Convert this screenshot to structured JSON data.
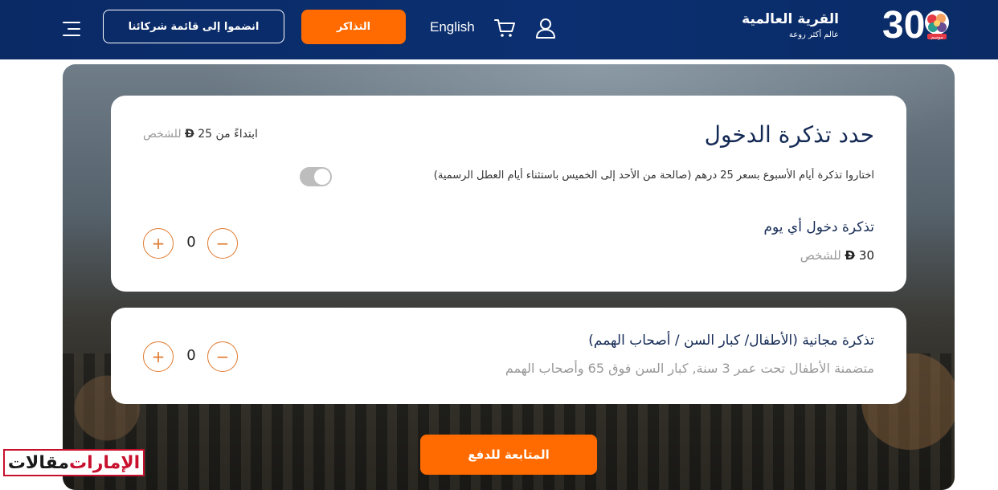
{
  "header": {
    "logo": {
      "title": "القرية العالمية",
      "tagline": "عالم أكثر روعة",
      "season_number": "30",
      "season_label": "موسم"
    },
    "partner_button": "انضموا إلى قائمة شركائنا",
    "tickets_button": "التذاكر",
    "language_link": "English",
    "icons": [
      "menu-icon",
      "cart-icon",
      "user-icon"
    ]
  },
  "ticket_panel": {
    "title": "حدد تذكرة الدخول",
    "starting_price": {
      "prefix": "ابتداءً من",
      "amount": "25",
      "currency_symbol": "Đ",
      "unit": "للشخص"
    },
    "weekday_toggle": {
      "label": "اختاروا تذكرة أيام الأسبوع بسعر 25 درهم (صالحة من الأحد إلى الخميس باستثناء أيام العطل الرسمية)",
      "on": false
    },
    "tickets": [
      {
        "name": "تذكرة دخول أي يوم",
        "price": "30",
        "currency_symbol": "Đ",
        "unit": "للشخص",
        "quantity": "0"
      },
      {
        "name": "تذكرة مجانية (الأطفال/ كبار السن / أصحاب الهمم)",
        "description": "متضمنة الأطفال تحت عمر 3 سنة, كبار السن فوق 65 وأصحاب الهمم",
        "quantity": "0"
      }
    ]
  },
  "checkout_button": "المتابعة للدفع",
  "watermark": {
    "part1": "مقالات",
    "part2": "الإمارات"
  },
  "colors": {
    "header_bg": "#0b2f70",
    "accent": "#ff6b00",
    "title": "#142a55"
  }
}
